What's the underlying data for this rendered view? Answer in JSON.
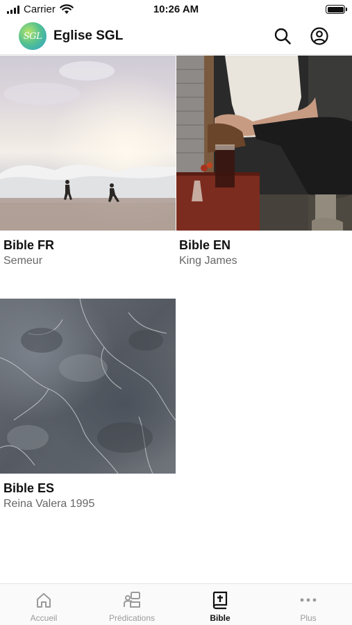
{
  "status_bar": {
    "carrier": "Carrier",
    "time": "10:26 AM"
  },
  "header": {
    "logo_text": "SGL",
    "title": "Eglise SGL",
    "search_icon": "search-icon",
    "account_icon": "account-circle-icon"
  },
  "bibles": [
    {
      "title": "Bible FR",
      "subtitle": "Semeur",
      "image": "beach-surfers-photo"
    },
    {
      "title": "Bible EN",
      "subtitle": "King James",
      "image": "person-seated-with-drink-photo"
    },
    {
      "title": "Bible ES",
      "subtitle": "Reina Valera 1995",
      "image": "grey-marble-texture-photo"
    }
  ],
  "tab_bar": {
    "tabs": [
      {
        "label": "Accueil",
        "icon": "home-icon"
      },
      {
        "label": "Prédications",
        "icon": "speaker-podium-icon"
      },
      {
        "label": "Bible",
        "icon": "bible-book-icon"
      },
      {
        "label": "Plus",
        "icon": "more-dots-icon"
      }
    ],
    "active": "Bible"
  },
  "colors": {
    "text": "#111111",
    "secondary_text": "#666666",
    "inactive_tab": "#9a9a9a",
    "divider": "#e4e4e4"
  }
}
